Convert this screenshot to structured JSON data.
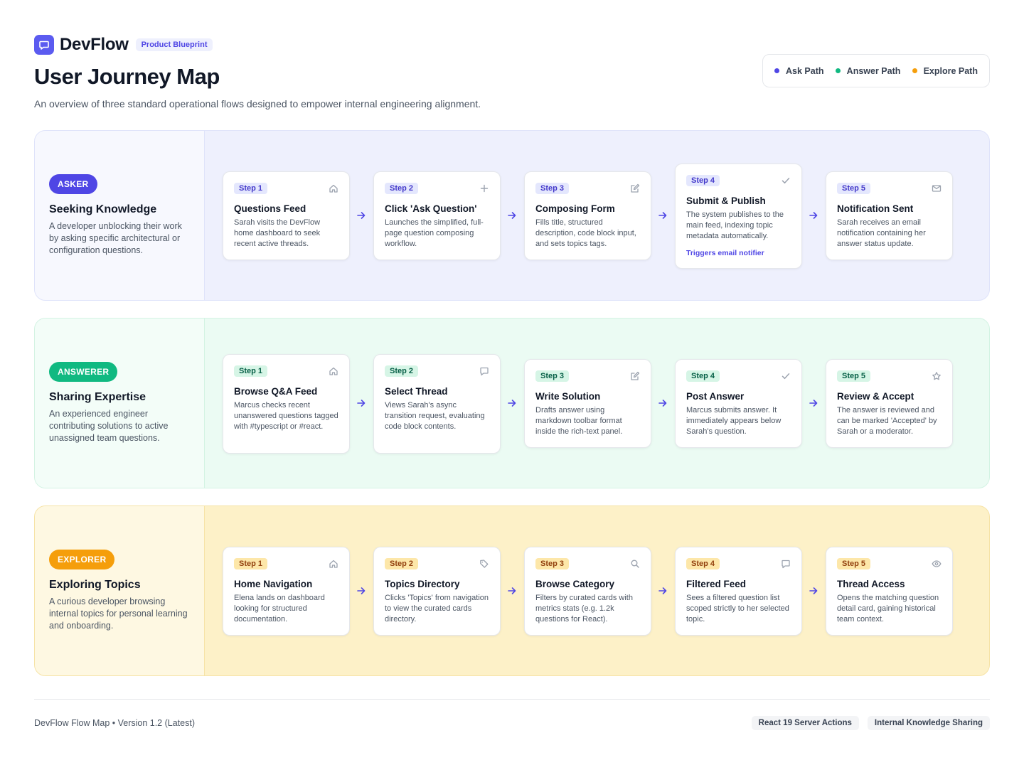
{
  "brand": {
    "name": "DevFlow",
    "badge": "Product Blueprint"
  },
  "page": {
    "title": "User Journey Map",
    "subtitle": "An overview of three standard operational flows designed to empower internal engineering alignment."
  },
  "legend": [
    {
      "label": "Ask Path",
      "color": "#4f46e5"
    },
    {
      "label": "Answer Path",
      "color": "#10b981"
    },
    {
      "label": "Explore Path",
      "color": "#f59e0b"
    }
  ],
  "lanes": [
    {
      "badge": "ASKER",
      "title": "Seeking Knowledge",
      "description": "A developer unblocking their work by asking specific architectural or configuration questions.",
      "accent": "#4f46e5",
      "steps": [
        {
          "step": "Step 1",
          "icon": "home-icon",
          "title": "Questions Feed",
          "description": "Sarah visits the DevFlow home dashboard to seek recent active threads."
        },
        {
          "step": "Step 2",
          "icon": "plus-icon",
          "title": "Click 'Ask Question'",
          "description": "Launches the simplified, full-page question composing workflow."
        },
        {
          "step": "Step 3",
          "icon": "edit-icon",
          "title": "Composing Form",
          "description": "Fills title, structured description, code block input, and sets topics tags."
        },
        {
          "step": "Step 4",
          "icon": "check-icon",
          "title": "Submit & Publish",
          "description": "The system publishes to the main feed, indexing topic metadata automatically.",
          "note": "Triggers email notifier"
        },
        {
          "step": "Step 5",
          "icon": "mail-icon",
          "title": "Notification Sent",
          "description": "Sarah receives an email notification containing her answer status update."
        }
      ]
    },
    {
      "badge": "ANSWERER",
      "title": "Sharing Expertise",
      "description": "An experienced engineer contributing solutions to active unassigned team questions.",
      "accent": "#10b981",
      "steps": [
        {
          "step": "Step 1",
          "icon": "home-icon",
          "title": "Browse Q&A Feed",
          "description": "Marcus checks recent unanswered questions tagged with #typescript or #react."
        },
        {
          "step": "Step 2",
          "icon": "chat-icon",
          "title": "Select Thread",
          "description": "Views Sarah's async transition request, evaluating code block contents."
        },
        {
          "step": "Step 3",
          "icon": "edit-icon",
          "title": "Write Solution",
          "description": "Drafts answer using markdown toolbar format inside the rich-text panel."
        },
        {
          "step": "Step 4",
          "icon": "check-icon",
          "title": "Post Answer",
          "description": "Marcus submits answer. It immediately appears below Sarah's question."
        },
        {
          "step": "Step 5",
          "icon": "star-icon",
          "title": "Review & Accept",
          "description": "The answer is reviewed and can be marked 'Accepted' by Sarah or a moderator."
        }
      ]
    },
    {
      "badge": "EXPLORER",
      "title": "Exploring Topics",
      "description": "A curious developer browsing internal topics for personal learning and onboarding.",
      "accent": "#f59e0b",
      "steps": [
        {
          "step": "Step 1",
          "icon": "home-icon",
          "title": "Home Navigation",
          "description": "Elena lands on dashboard looking for structured documentation."
        },
        {
          "step": "Step 2",
          "icon": "tag-icon",
          "title": "Topics Directory",
          "description": "Clicks 'Topics' from navigation to view the curated cards directory."
        },
        {
          "step": "Step 3",
          "icon": "search-icon",
          "title": "Browse Category",
          "description": "Filters by curated cards with metrics stats (e.g. 1.2k questions for React)."
        },
        {
          "step": "Step 4",
          "icon": "chat-icon",
          "title": "Filtered Feed",
          "description": "Sees a filtered question list scoped strictly to her selected topic."
        },
        {
          "step": "Step 5",
          "icon": "eye-icon",
          "title": "Thread Access",
          "description": "Opens the matching question detail card, gaining historical team context."
        }
      ]
    }
  ],
  "footer": {
    "text": "DevFlow Flow Map • Version 1.2 (Latest)",
    "tags": [
      "React 19 Server Actions",
      "Internal Knowledge Sharing"
    ]
  }
}
